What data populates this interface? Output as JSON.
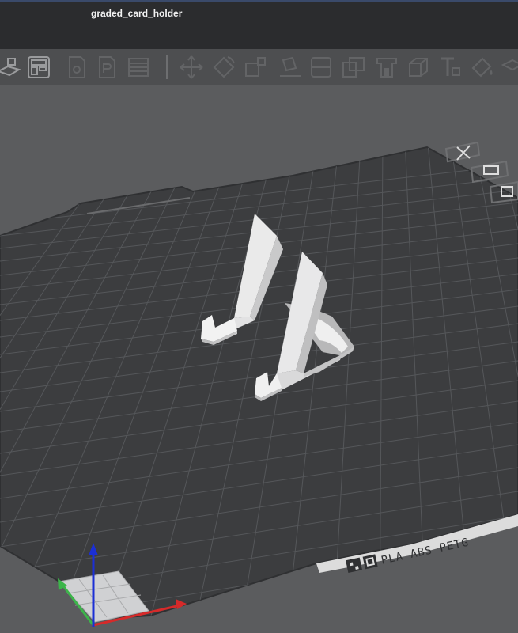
{
  "window": {
    "title": "graded_card_holder"
  },
  "toolbar": {
    "buttons": [
      {
        "name": "add-plate-icon"
      },
      {
        "name": "arrange-layout-icon"
      },
      {
        "name": "orient-icon"
      },
      {
        "name": "print-settings-icon"
      },
      {
        "name": "layers-icon"
      },
      {
        "name": "move-icon"
      },
      {
        "name": "rotate-icon"
      },
      {
        "name": "scale-icon"
      },
      {
        "name": "place-on-face-icon"
      },
      {
        "name": "cut-icon"
      },
      {
        "name": "boolean-icon"
      },
      {
        "name": "support-paint-icon"
      },
      {
        "name": "seam-paint-icon"
      },
      {
        "name": "text-tool-icon"
      },
      {
        "name": "color-paint-icon"
      }
    ]
  },
  "viewport": {
    "plate_label": "PLA ABS PETG",
    "model_name": "graded_card_holder",
    "colors": {
      "background": "#5b5c5e",
      "plate": "#3c3d3f",
      "grid": "#55575a",
      "model": "#dcdcdc",
      "axis_x": "#d62a2a",
      "axis_y": "#3cb54a",
      "axis_z": "#1b2fd6"
    }
  }
}
